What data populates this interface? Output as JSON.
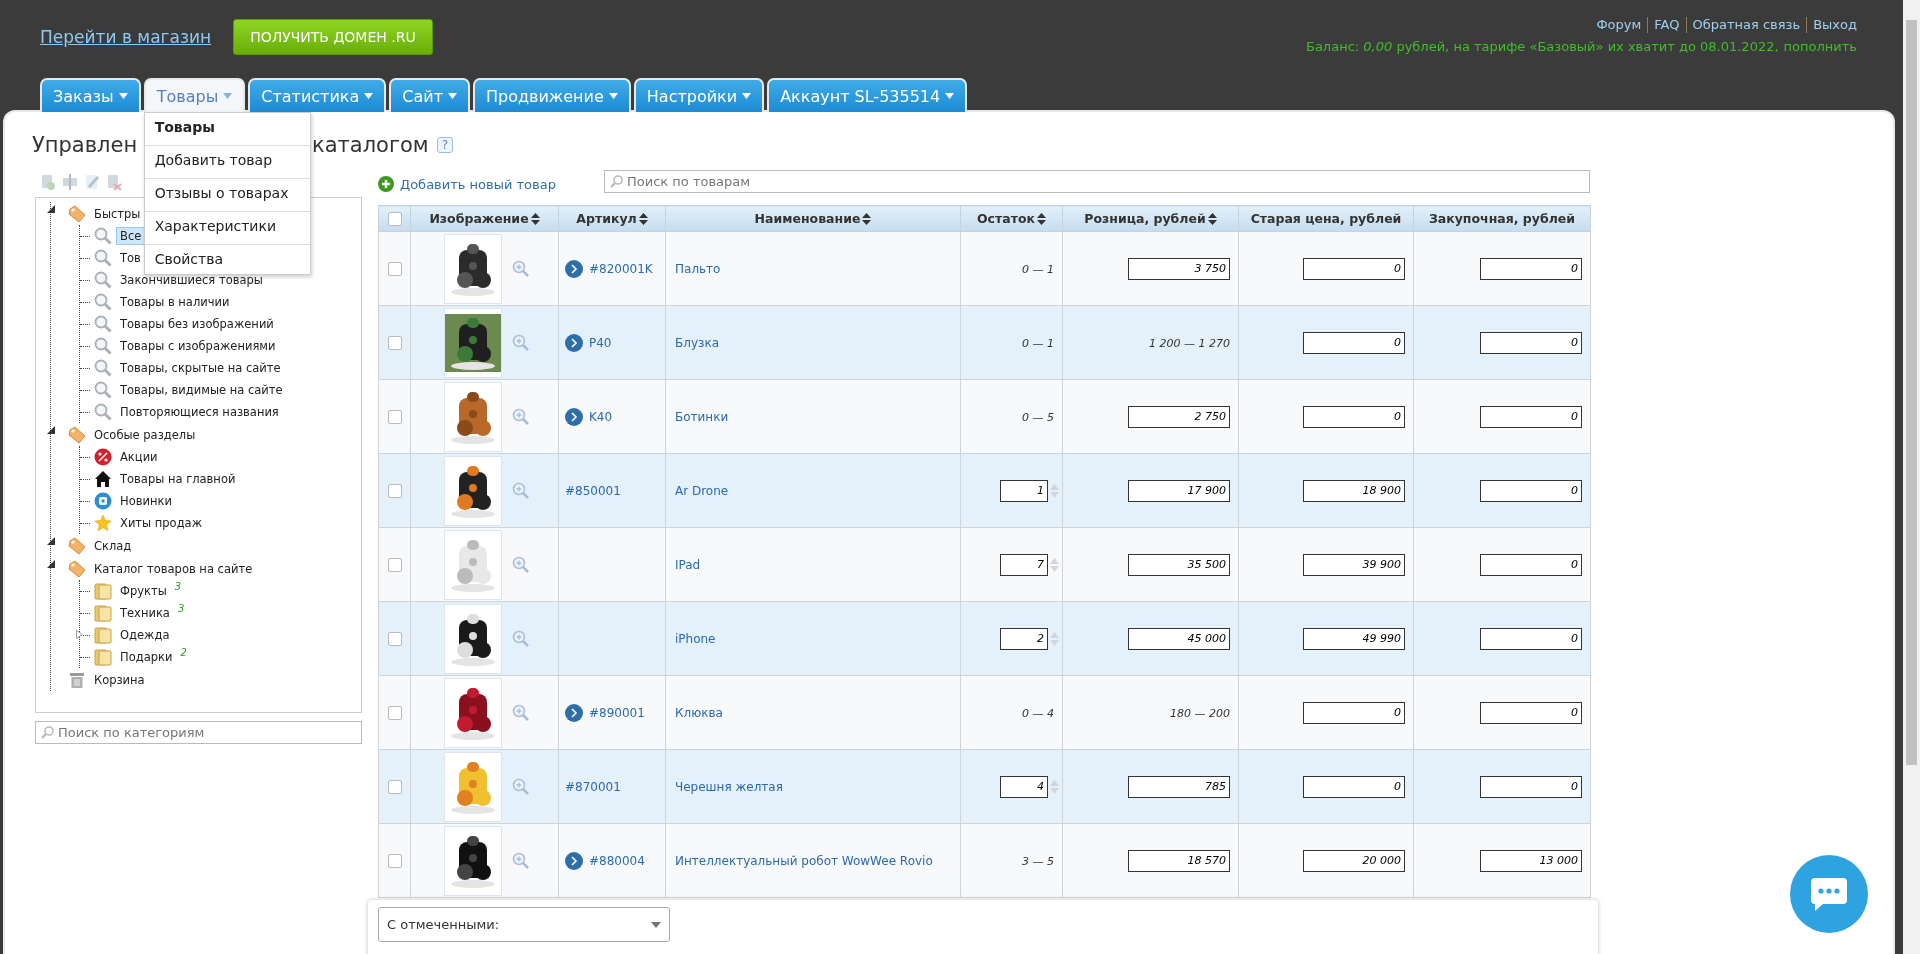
{
  "header": {
    "shop_link": "Перейти в магазин",
    "domain_button": "ПОЛУЧИТЬ ДОМЕН .RU",
    "top_links": [
      "Форум",
      "FAQ",
      "Обратная связь",
      "Выход"
    ],
    "balance": {
      "text": "Баланс: *0,00* рублей, на тарифе «Базовый» их хватит до 08.01.2022,",
      "link": "пополнить"
    }
  },
  "tabs": [
    {
      "label": "Заказы",
      "selected": false
    },
    {
      "label": "Товары",
      "selected": true,
      "menu": [
        {
          "label": "Товары",
          "selected": true
        },
        {
          "label": "Добавить товар",
          "selected": false
        },
        {
          "label": "Отзывы о товарах",
          "selected": false
        },
        {
          "label": "Характеристики",
          "selected": false
        },
        {
          "label": "Свойства",
          "selected": false
        }
      ]
    },
    {
      "label": "Статистика",
      "selected": false
    },
    {
      "label": "Сайт",
      "selected": false
    },
    {
      "label": "Продвижение",
      "selected": false
    },
    {
      "label": "Настройки",
      "selected": false
    },
    {
      "label": "Аккаунт SL-535514",
      "selected": false
    }
  ],
  "page_title_parts": [
    "Управлен",
    "каталогом"
  ],
  "help": "?",
  "tree_toolbar": [
    {
      "kind": "add",
      "disabled": true
    },
    {
      "kind": "move",
      "disabled": true
    },
    {
      "kind": "edit",
      "disabled": true
    },
    {
      "kind": "delete",
      "disabled": true
    }
  ],
  "tree": [
    {
      "label": "Быстры",
      "kind": "section",
      "expanded": true,
      "selected": false,
      "children": [
        {
          "label": "Все",
          "kind": "filter",
          "selected": true
        },
        {
          "label": "Тов",
          "kind": "filter",
          "selected": false
        },
        {
          "label": "Закончившиеся товары",
          "kind": "filter",
          "selected": false
        },
        {
          "label": "Товары в наличии",
          "kind": "filter",
          "selected": false
        },
        {
          "label": "Товары без изображений",
          "kind": "filter",
          "selected": false
        },
        {
          "label": "Товары с изображениями",
          "kind": "filter",
          "selected": false
        },
        {
          "label": "Товары, скрытые на сайте",
          "kind": "filter",
          "selected": false
        },
        {
          "label": "Товары, видимые на сайте",
          "kind": "filter",
          "selected": false
        },
        {
          "label": "Повторяющиеся названия",
          "kind": "filter",
          "selected": false
        }
      ]
    },
    {
      "label": "Особые разделы",
      "kind": "section",
      "expanded": true,
      "selected": false,
      "children": [
        {
          "label": "Акции",
          "kind": "promo",
          "selected": false
        },
        {
          "label": "Товары на главной",
          "kind": "home",
          "selected": false
        },
        {
          "label": "Новинки",
          "kind": "new",
          "selected": false
        },
        {
          "label": "Хиты продаж",
          "kind": "hit",
          "selected": false
        }
      ]
    },
    {
      "label": "Склад",
      "kind": "section",
      "expanded": true,
      "selected": false
    },
    {
      "label": "Каталог товаров на сайте",
      "kind": "section",
      "expanded": true,
      "selected": false,
      "children": [
        {
          "label": "Фрукты",
          "kind": "folder",
          "count": "3",
          "selected": false
        },
        {
          "label": "Техника",
          "kind": "folder",
          "count": "3",
          "selected": false
        },
        {
          "label": "Одежда",
          "kind": "folder",
          "expanded": false,
          "selected": false
        },
        {
          "label": "Подарки",
          "kind": "folder",
          "count": "2",
          "selected": false
        }
      ]
    },
    {
      "label": "Корзина",
      "kind": "trash",
      "selected": false
    }
  ],
  "category_search": {
    "placeholder": "Поиск по категориям"
  },
  "add_product": "Добавить новый товар",
  "product_search": {
    "placeholder": "Поиск по товарам"
  },
  "table": {
    "select_all_checked": false,
    "columns": [
      {
        "label": "Изображение",
        "sortable": true
      },
      {
        "label": "Артикул",
        "sortable": true
      },
      {
        "label": "Наименование",
        "sortable": true
      },
      {
        "label": "Остаток",
        "sortable": true
      },
      {
        "label": "Розница, рублей",
        "sortable": true
      },
      {
        "label": "Старая цена, рублей",
        "sortable": false
      },
      {
        "label": "Закупочная, рублей",
        "sortable": false
      }
    ],
    "rows": [
      {
        "checked": false,
        "sku": "#820001K",
        "variants_arrow": true,
        "name": "Пальто",
        "stock": {
          "kind": "range",
          "value": "0 — 1"
        },
        "retail": {
          "kind": "input",
          "value": "3 750"
        },
        "old_price": "0",
        "purchase": "0"
      },
      {
        "checked": false,
        "sku": "P40",
        "variants_arrow": true,
        "name": "Блузка",
        "stock": {
          "kind": "range",
          "value": "0 — 1"
        },
        "retail": {
          "kind": "range",
          "value": "1 200 — 1 270"
        },
        "old_price": "0",
        "purchase": "0"
      },
      {
        "checked": false,
        "sku": "K40",
        "variants_arrow": true,
        "name": "Ботинки",
        "stock": {
          "kind": "range",
          "value": "0 — 5"
        },
        "retail": {
          "kind": "input",
          "value": "2 750"
        },
        "old_price": "0",
        "purchase": "0"
      },
      {
        "checked": false,
        "sku": "#850001",
        "variants_arrow": false,
        "name": "Ar Drone",
        "stock": {
          "kind": "input",
          "value": "1"
        },
        "retail": {
          "kind": "input",
          "value": "17 900"
        },
        "old_price": "18 900",
        "purchase": "0"
      },
      {
        "checked": false,
        "variants_arrow": false,
        "name": "IPad",
        "stock": {
          "kind": "input",
          "value": "7"
        },
        "retail": {
          "kind": "input",
          "value": "35 500"
        },
        "old_price": "39 900",
        "purchase": "0"
      },
      {
        "checked": false,
        "variants_arrow": false,
        "name": "iPhone",
        "stock": {
          "kind": "input",
          "value": "2"
        },
        "retail": {
          "kind": "input",
          "value": "45 000"
        },
        "old_price": "49 990",
        "purchase": "0"
      },
      {
        "checked": false,
        "sku": "#890001",
        "variants_arrow": true,
        "name": "Клюква",
        "stock": {
          "kind": "range",
          "value": "0 — 4"
        },
        "retail": {
          "kind": "range",
          "value": "180 — 200"
        },
        "old_price": "0",
        "purchase": "0"
      },
      {
        "checked": false,
        "sku": "#870001",
        "variants_arrow": false,
        "name": "Черешня желтая",
        "stock": {
          "kind": "input",
          "value": "4"
        },
        "retail": {
          "kind": "input",
          "value": "785"
        },
        "old_price": "0",
        "purchase": "0"
      },
      {
        "checked": false,
        "sku": "#880004",
        "variants_arrow": true,
        "name": "Интеллектуальный робот WowWee Rovio",
        "stock": {
          "kind": "range",
          "value": "3 — 5"
        },
        "retail": {
          "kind": "input",
          "value": "18 570"
        },
        "old_price": "20 000",
        "purchase": "13 000"
      }
    ]
  },
  "bulk_select": {
    "value": "С отмеченными:"
  }
}
